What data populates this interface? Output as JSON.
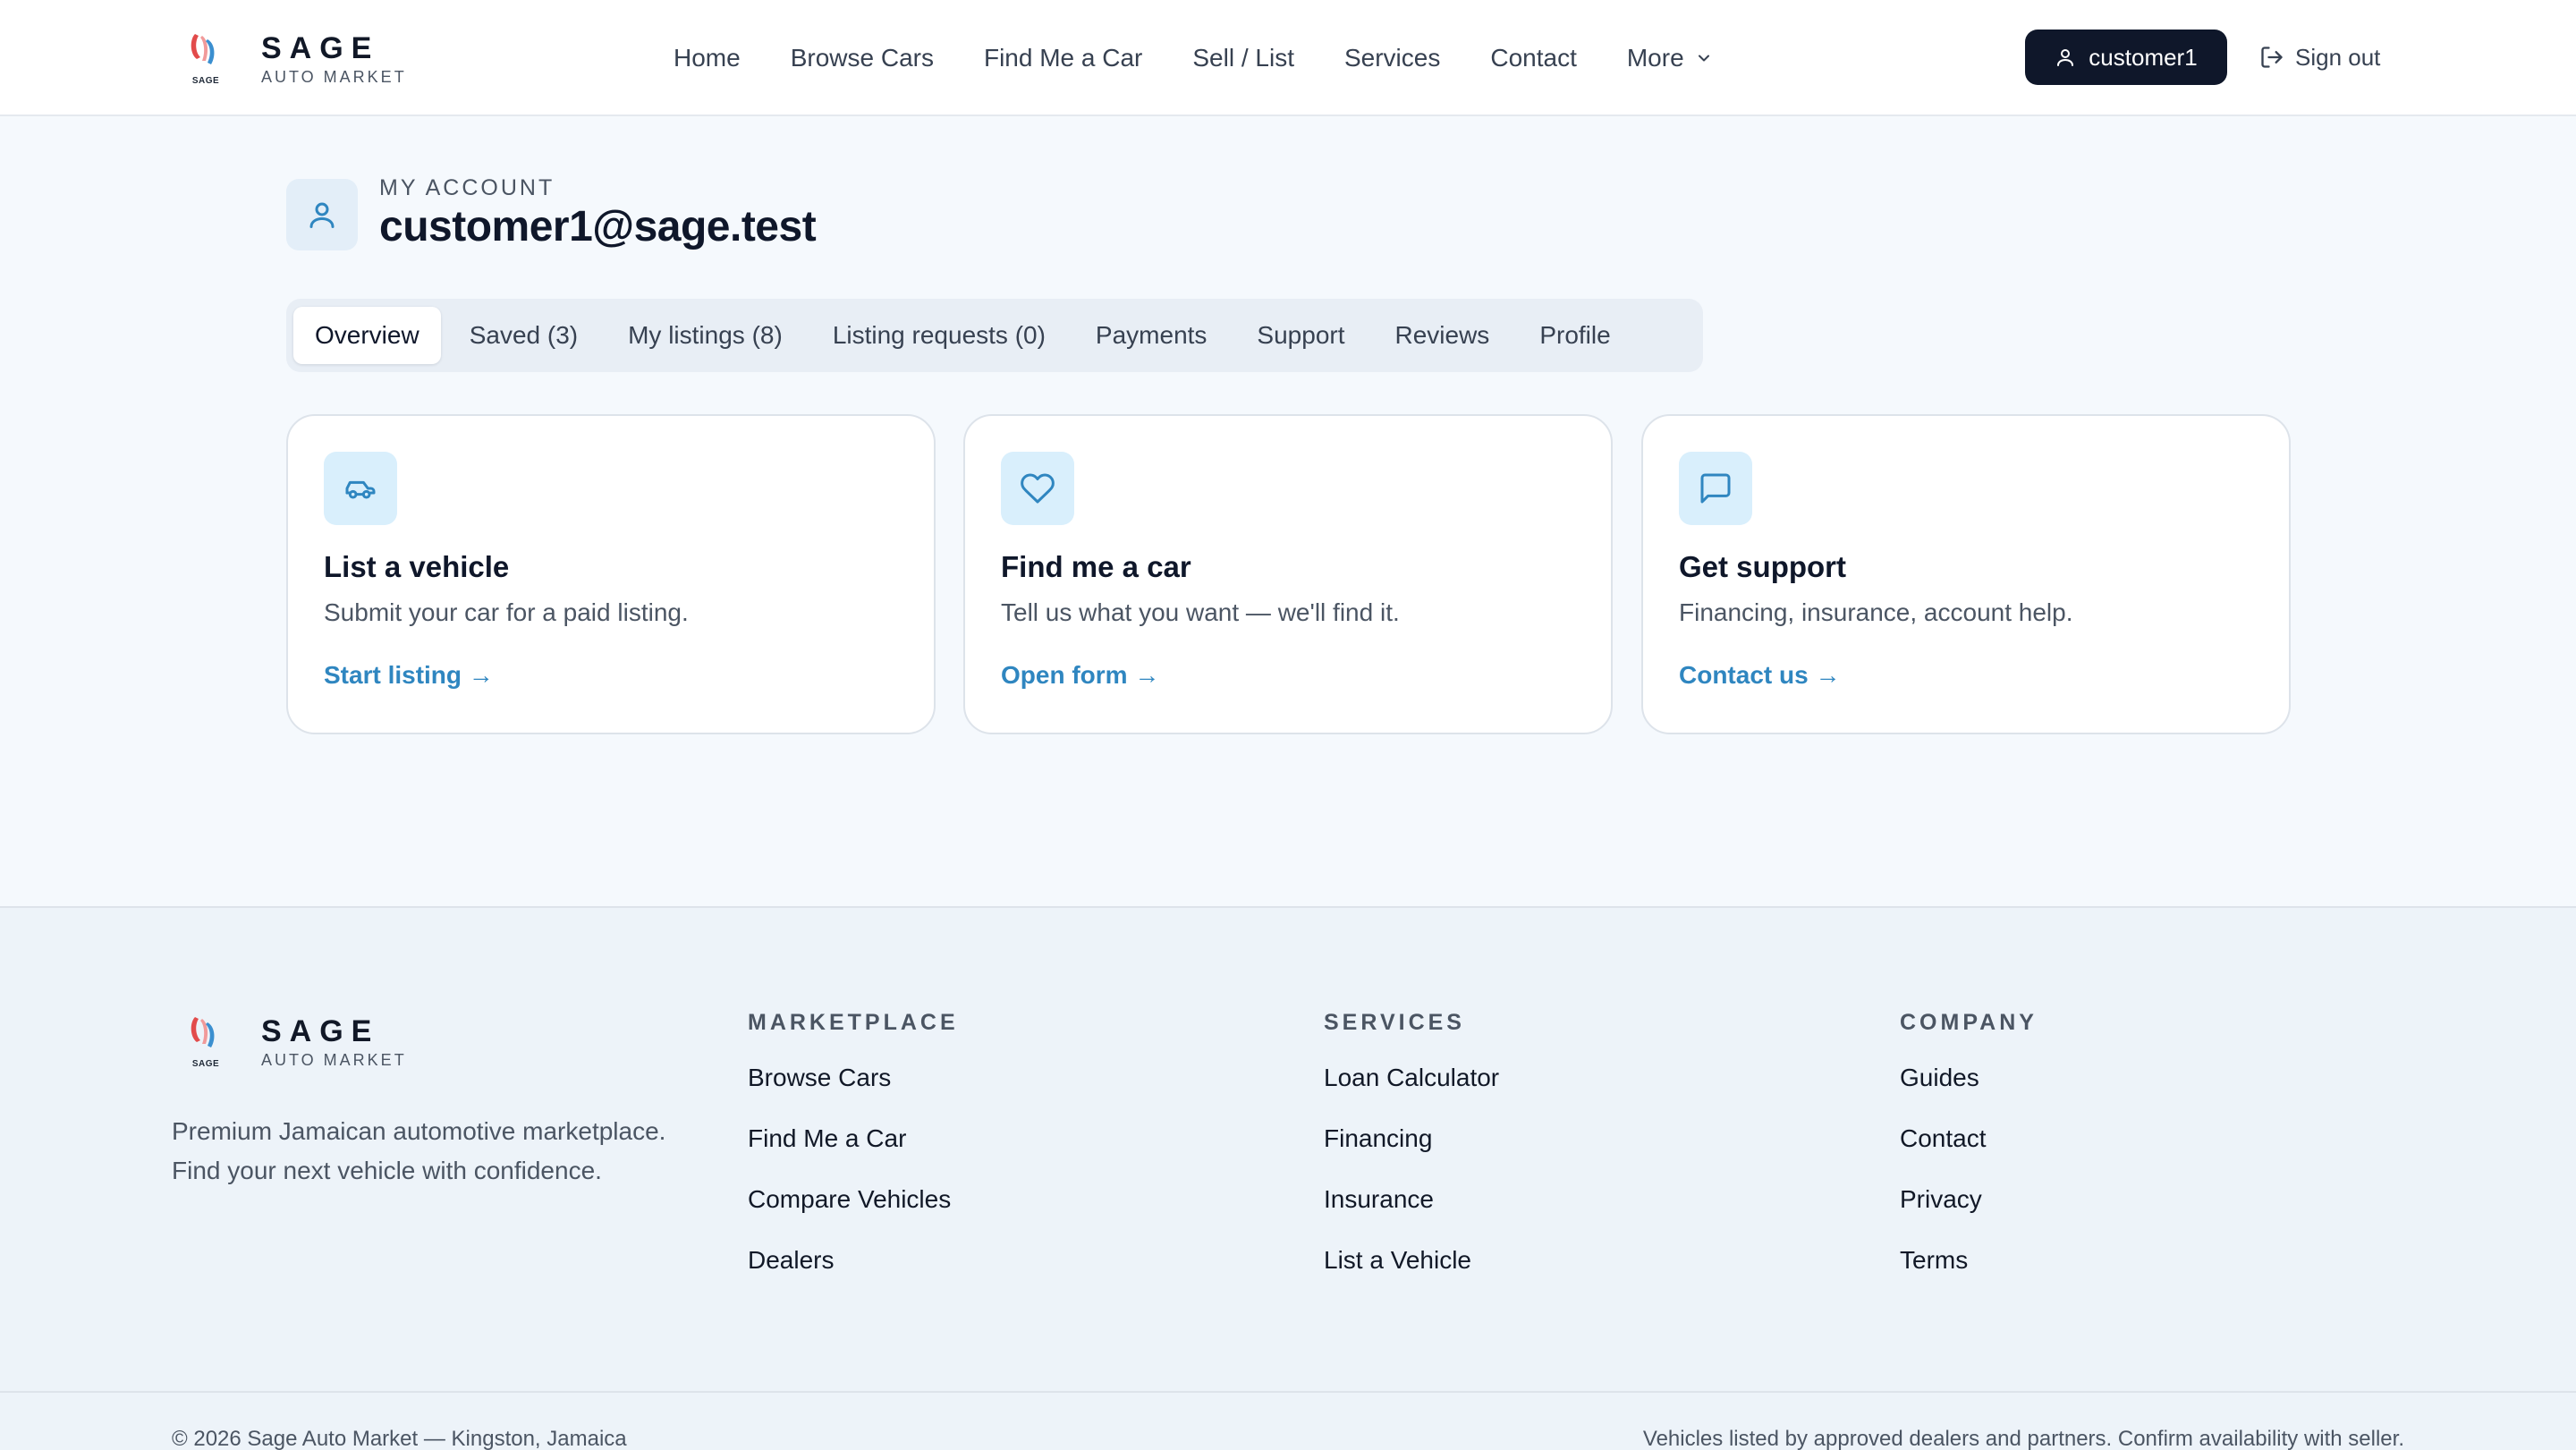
{
  "brand": {
    "name": "SAGE",
    "subtitle": "AUTO MARKET",
    "mark_caption": "SAGE",
    "colors": {
      "red": "#e24b4b",
      "blue": "#3b8fd0"
    }
  },
  "nav": {
    "items": [
      "Home",
      "Browse Cars",
      "Find Me a Car",
      "Sell / List",
      "Services",
      "Contact"
    ],
    "more_label": "More"
  },
  "header": {
    "user_label": "customer1",
    "signout_label": "Sign out"
  },
  "account": {
    "eyebrow": "MY ACCOUNT",
    "email": "customer1@sage.test"
  },
  "tabs": [
    "Overview",
    "Saved (3)",
    "My listings (8)",
    "Listing requests (0)",
    "Payments",
    "Support",
    "Reviews",
    "Profile"
  ],
  "active_tab": "Overview",
  "cards": [
    {
      "icon": "car-icon",
      "title": "List a vehicle",
      "description": "Submit your car for a paid listing.",
      "link": "Start listing →"
    },
    {
      "icon": "heart-icon",
      "title": "Find me a car",
      "description": "Tell us what you want — we'll find it.",
      "link": "Open form →"
    },
    {
      "icon": "message-icon",
      "title": "Get support",
      "description": "Financing, insurance, account help.",
      "link": "Contact us →"
    }
  ],
  "footer": {
    "tagline": "Premium Jamaican automotive marketplace. Find your next vehicle with confidence.",
    "columns": [
      {
        "heading": "MARKETPLACE",
        "links": [
          "Browse Cars",
          "Find Me a Car",
          "Compare Vehicles",
          "Dealers"
        ]
      },
      {
        "heading": "SERVICES",
        "links": [
          "Loan Calculator",
          "Financing",
          "Insurance",
          "List a Vehicle"
        ]
      },
      {
        "heading": "COMPANY",
        "links": [
          "Guides",
          "Contact",
          "Privacy",
          "Terms"
        ]
      }
    ],
    "copyright": "© 2026 Sage Auto Market — Kingston, Jamaica",
    "disclaimer": "Vehicles listed by approved dealers and partners. Confirm availability with seller."
  },
  "colors": {
    "accent": "#2f86c0",
    "dark": "#0f172a",
    "page_bg": "#f5f9fd",
    "icon_bg": "#d9effc"
  }
}
